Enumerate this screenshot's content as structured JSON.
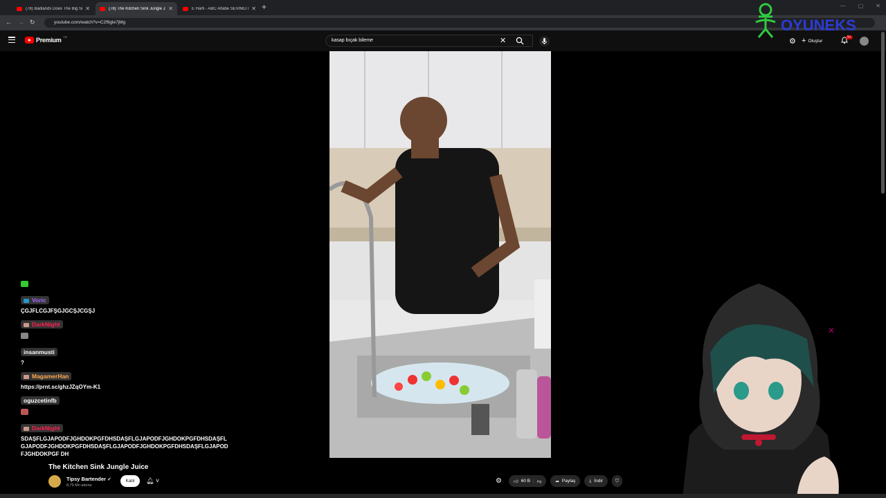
{
  "browser": {
    "tabs": [
      {
        "title": "(78) Badlands Does The Big Sm..."
      },
      {
        "title": "(78) The Kitchen Sink Jungle Ju..."
      },
      {
        "title": "E Harfi - ABC Alfabe SEVİMLİ D..."
      }
    ],
    "url": "youtube.com/watch?v=C2f9gle7jMg"
  },
  "header": {
    "logo_text": "Premium",
    "logo_region": "TR",
    "search_value": "kasap bıçak bileme",
    "create_label": "Oluştur",
    "notif_badge": "9+"
  },
  "overlay": {
    "brand": "OYUNEKS"
  },
  "chat": [
    {
      "user": "",
      "text": "",
      "color": "#ff3b5c",
      "emote": "#3c3"
    },
    {
      "user": "Voric",
      "text": "ÇGJFLCGJFŞGJGCŞJCGŞJ",
      "color": "#a56bff"
    },
    {
      "user": "DarkNight",
      "text": "",
      "color": "#ff2050",
      "emote": "#888"
    },
    {
      "user": "insanmusti",
      "text": "?",
      "color": "#ffffff"
    },
    {
      "user": "MagamerHan",
      "text": "https://prnt.sc/ghzJZqOYm-K1",
      "color": "#ffa94d"
    },
    {
      "user": "oguzcetinfb",
      "text": "",
      "color": "#ffffff",
      "emote": "#b55"
    },
    {
      "user": "DarkNight",
      "text": "SDAŞFLGJAPODFJGHDOKPGFDHSDAŞFLGJAPODFJGHDOKPGFDHSDAŞFLGJAPODFJGHDOKPGFDHSDAŞFLGJAPODFJGHDOKPGFDHSDAŞFLGJAPODFJGHDOKPGF DH",
      "color": "#ff2050"
    }
  ],
  "video": {
    "title": "The Kitchen Sink Jungle Juice",
    "channel": "Tipsy Bartender",
    "subscribers": "8,79 Mn abone",
    "join_label": "Katıl",
    "likes": "60 B",
    "share_label": "Paylaş",
    "download_label": "İndir"
  }
}
